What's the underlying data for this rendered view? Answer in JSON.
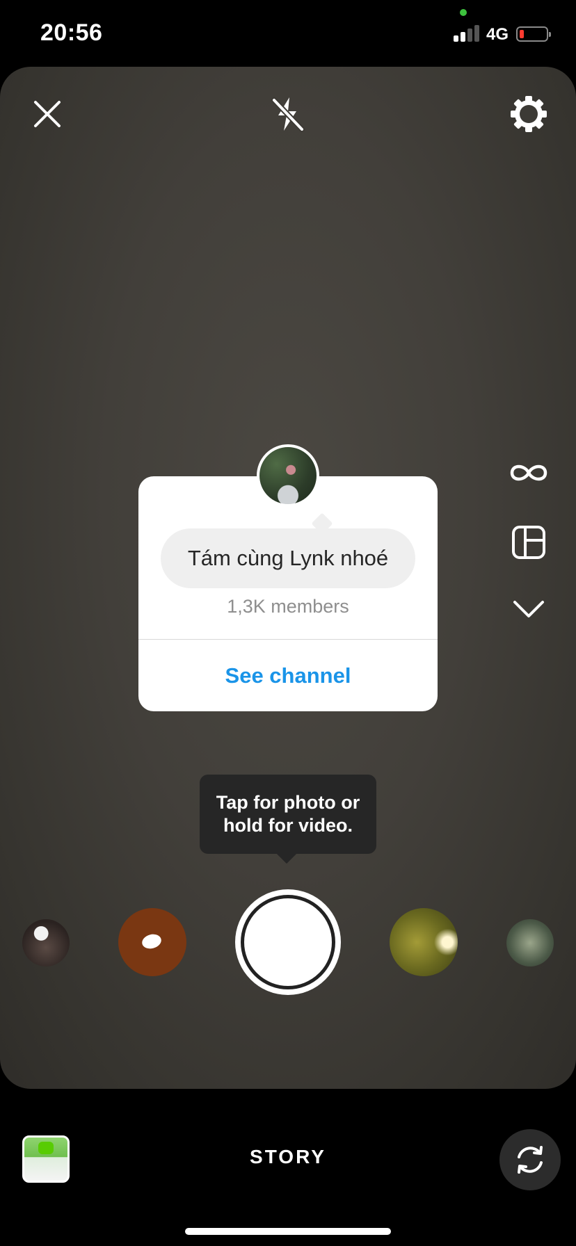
{
  "status_bar": {
    "time": "20:56",
    "network": "4G",
    "battery_color": "#ff3b30",
    "camera_in_use_dot": "#3ec23e"
  },
  "camera_top": {
    "close_icon": "close-icon",
    "flash_icon": "flash-off-icon",
    "settings_icon": "gear-icon"
  },
  "right_tools": [
    "boomerang-icon",
    "layout-icon",
    "chevron-down-icon"
  ],
  "channel_card": {
    "channel_name": "Tám cùng Lynk nhoé",
    "members": "1,3K members",
    "action_label": "See channel",
    "action_color": "#1a94e8"
  },
  "tooltip": {
    "text": "Tap for photo or hold for video."
  },
  "bottom_bar": {
    "mode_label": "STORY",
    "flip_icon": "flip-camera-icon"
  }
}
